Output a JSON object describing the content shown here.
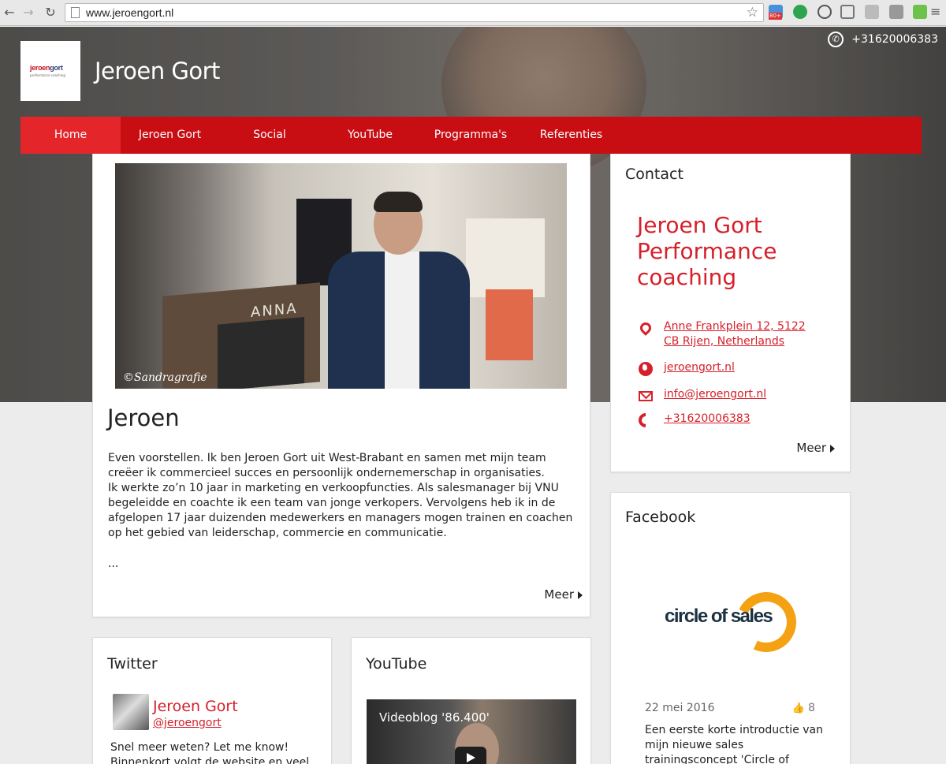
{
  "browser": {
    "url": "www.jeroengort.nl",
    "back_icon": "arrow-left-icon",
    "forward_icon": "arrow-right-icon",
    "reload_icon": "reload-icon",
    "badge_count": "80+"
  },
  "header": {
    "logo_brand_main": "jeroen",
    "logo_brand_accent": "gort",
    "logo_tagline": "performance coaching",
    "site_title": "Jeroen Gort",
    "phone": "+31620006383"
  },
  "nav": {
    "items": [
      {
        "label": "Home",
        "active": true
      },
      {
        "label": "Jeroen Gort",
        "active": false
      },
      {
        "label": "Social",
        "active": false
      },
      {
        "label": "YouTube",
        "active": false
      },
      {
        "label": "Programma's",
        "active": false
      },
      {
        "label": "Referenties",
        "active": false
      }
    ]
  },
  "article": {
    "photo_credit": "©Sandragrafie",
    "lectern_brand": "ANNA",
    "title": "Jeroen",
    "paragraphs": [
      "Even voorstellen. Ik ben Jeroen Gort uit West-Brabant en samen met mijn team creëer ik commercieel succes en persoonlijk ondernemerschap in organisaties.",
      "Ik werkte zo’n 10 jaar in marketing en verkoopfuncties. Als salesmanager bij VNU begeleidde en coachte ik een team van jonge verkopers. Vervolgens heb ik in de afgelopen 17 jaar duizenden medewerkers en managers mogen trainen en coachen op het gebied van leiderschap, commercie en communicatie."
    ],
    "ellipsis": "...",
    "more": "Meer"
  },
  "contact": {
    "heading": "Contact",
    "company": "Jeroen Gort Performance coaching",
    "address": "Anne Frankplein 12, 5122 CB Rijen, Netherlands",
    "website": "jeroengort.nl",
    "email": "info@jeroengort.nl",
    "phone": "+31620006383",
    "more": "Meer"
  },
  "facebook": {
    "heading": "Facebook",
    "logo_text": "circle of sales",
    "date": "22 mei 2016",
    "likes": "8",
    "post": "Een eerste korte introductie van mijn nieuwe sales trainingsconcept 'Circle of"
  },
  "twitter": {
    "heading": "Twitter",
    "name": "Jeroen Gort",
    "handle": "@jeroengort",
    "tweet": "Snel meer weten? Let me know! Binnenkort volgt de website en veel"
  },
  "youtube": {
    "heading": "YouTube",
    "video_title": "Videoblog '86.400'"
  },
  "colors": {
    "brand_red": "#c80d13",
    "nav_active": "#e4262b",
    "link_red": "#d6202a",
    "circle_orange": "#f4a213"
  }
}
